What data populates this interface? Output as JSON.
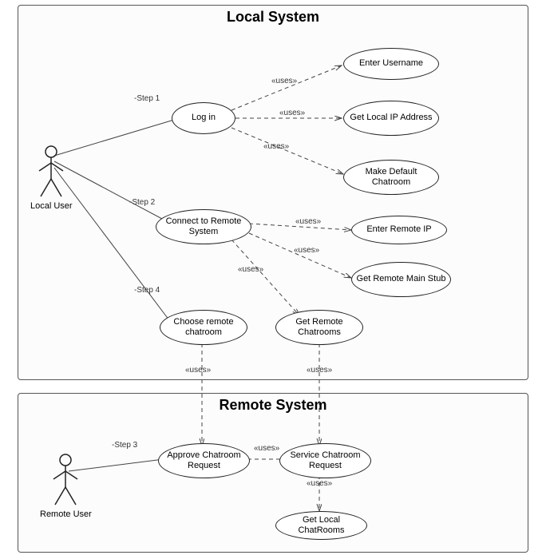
{
  "systems": {
    "local": {
      "title": "Local System"
    },
    "remote": {
      "title": "Remote System"
    }
  },
  "actors": {
    "local": "Local User",
    "remote": "Remote User"
  },
  "usecases": {
    "login": "Log in",
    "enter_username": "Enter Username",
    "get_local_ip": "Get Local IP Address",
    "make_default_chatroom": "Make Default Chatroom",
    "connect_remote": "Connect to Remote System",
    "enter_remote_ip": "Enter Remote IP",
    "get_remote_main_stub": "Get Remote Main Stub",
    "choose_remote_chatroom": "Choose remote chatroom",
    "get_remote_chatrooms": "Get Remote Chatrooms",
    "approve_chatroom_request": "Approve Chatroom Request",
    "service_chatroom_request": "Service Chatroom Request",
    "get_local_chatrooms": "Get Local ChatRooms"
  },
  "labels": {
    "step1": "-Step 1",
    "step2": "-Step 2",
    "step3": "-Step 3",
    "step4": "-Step 4",
    "uses": "«uses»"
  },
  "chart_data": {
    "type": "uml_use_case_diagram",
    "systems": [
      {
        "name": "Local System",
        "usecases": [
          "Log in",
          "Enter Username",
          "Get Local IP Address",
          "Make Default Chatroom",
          "Connect to Remote System",
          "Enter Remote IP",
          "Get Remote Main Stub",
          "Choose remote chatroom",
          "Get Remote Chatrooms"
        ]
      },
      {
        "name": "Remote System",
        "usecases": [
          "Approve Chatroom Request",
          "Service Chatroom Request",
          "Get Local ChatRooms"
        ]
      }
    ],
    "actors": [
      {
        "name": "Local User",
        "associations": [
          "Log in",
          "Connect to Remote System",
          "Choose remote chatroom"
        ]
      },
      {
        "name": "Remote User",
        "associations": [
          "Approve Chatroom Request"
        ]
      }
    ],
    "relationships": [
      {
        "from": "Log in",
        "to": "Enter Username",
        "type": "uses"
      },
      {
        "from": "Log in",
        "to": "Get Local IP Address",
        "type": "uses"
      },
      {
        "from": "Log in",
        "to": "Make Default Chatroom",
        "type": "uses"
      },
      {
        "from": "Connect to Remote System",
        "to": "Enter Remote IP",
        "type": "uses"
      },
      {
        "from": "Connect to Remote System",
        "to": "Get Remote Main Stub",
        "type": "uses"
      },
      {
        "from": "Connect to Remote System",
        "to": "Get Remote Chatrooms",
        "type": "uses"
      },
      {
        "from": "Choose remote chatroom",
        "to": "Approve Chatroom Request",
        "type": "uses"
      },
      {
        "from": "Get Remote Chatrooms",
        "to": "Service Chatroom Request",
        "type": "uses"
      },
      {
        "from": "Approve Chatroom Request",
        "to": "Service Chatroom Request",
        "type": "uses"
      },
      {
        "from": "Service Chatroom Request",
        "to": "Get Local ChatRooms",
        "type": "uses"
      }
    ],
    "steps": [
      {
        "step": 1,
        "actor": "Local User",
        "usecase": "Log in"
      },
      {
        "step": 2,
        "actor": "Local User",
        "usecase": "Connect to Remote System"
      },
      {
        "step": 3,
        "actor": "Remote User",
        "usecase": "Approve Chatroom Request"
      },
      {
        "step": 4,
        "actor": "Local User",
        "usecase": "Choose remote chatroom"
      }
    ]
  }
}
